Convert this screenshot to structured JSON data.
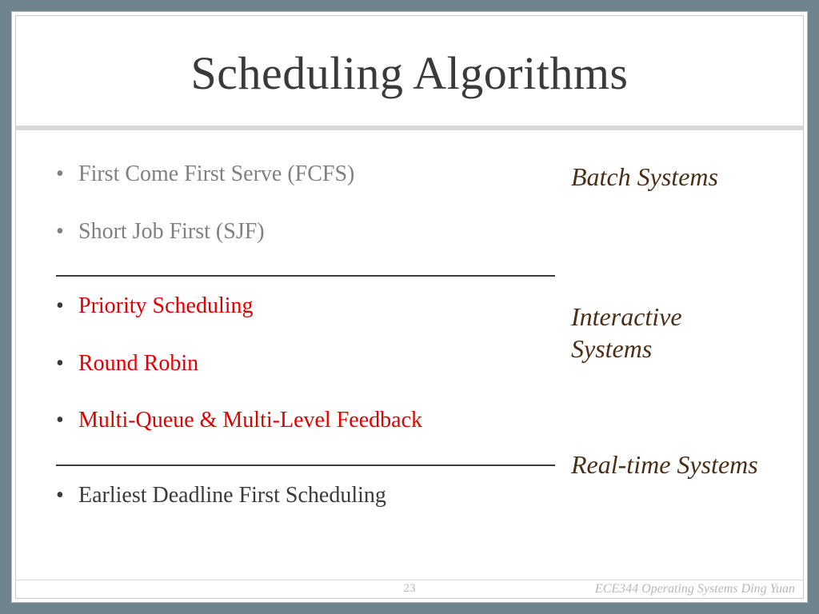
{
  "slide": {
    "title": "Scheduling Algorithms",
    "page_number": "23",
    "course_footer": "ECE344 Operating Systems Ding Yuan"
  },
  "categories": {
    "batch": "Batch Systems",
    "interactive": "Interactive Systems",
    "realtime": "Real-time Systems"
  },
  "bullets": {
    "batch": [
      "First Come First Serve (FCFS)",
      "Short Job First (SJF)"
    ],
    "interactive": [
      "Priority Scheduling",
      "Round Robin",
      "Multi-Queue & Multi-Level Feedback"
    ],
    "realtime": [
      "Earliest Deadline First Scheduling"
    ]
  }
}
